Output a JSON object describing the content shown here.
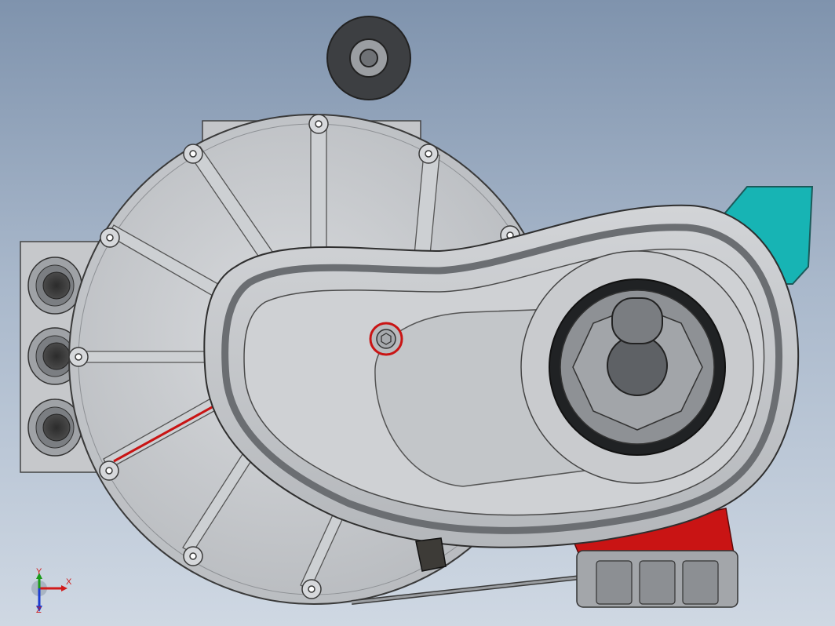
{
  "viewport": {
    "colors": {
      "bg_top": "#7f93ad",
      "bg_bottom": "#cfd8e3",
      "housing": "#c7c9cc",
      "housing_dark": "#9a9da2",
      "accent_red": "#c91414",
      "bracket_teal": "#17b4b4",
      "edge": "#333333"
    }
  },
  "triad": {
    "x_label": "X",
    "y_label": "Y",
    "z_label": "Z"
  }
}
